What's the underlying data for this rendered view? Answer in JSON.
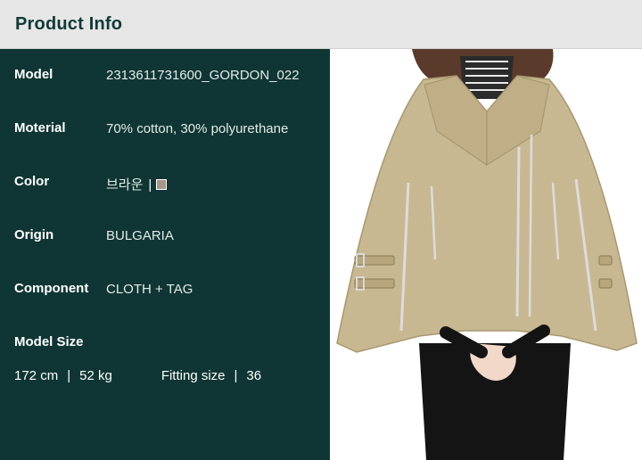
{
  "header": {
    "title": "Product Info"
  },
  "specs": [
    {
      "label": "Model",
      "value": "2313611731600_GORDON_022"
    },
    {
      "label": "Moterial",
      "value": "70% cotton, 30% polyurethane"
    },
    {
      "label": "Color",
      "value": "브라운"
    },
    {
      "label": "Origin",
      "value": "BULGARIA"
    },
    {
      "label": "Component",
      "value": "CLOTH + TAG"
    }
  ],
  "color_swatch": {
    "separator": "|",
    "hex": "#a8958a"
  },
  "model_size": {
    "label": "Model Size",
    "height": "172 cm",
    "separator": "|",
    "weight": "52 kg",
    "fitting_label": "Fitting size",
    "fitting_value": "36"
  },
  "colors": {
    "panel_bg": "#0f3634",
    "header_bg": "#e6e6e6",
    "header_text": "#0f3a36",
    "cape": "#c8b891"
  }
}
